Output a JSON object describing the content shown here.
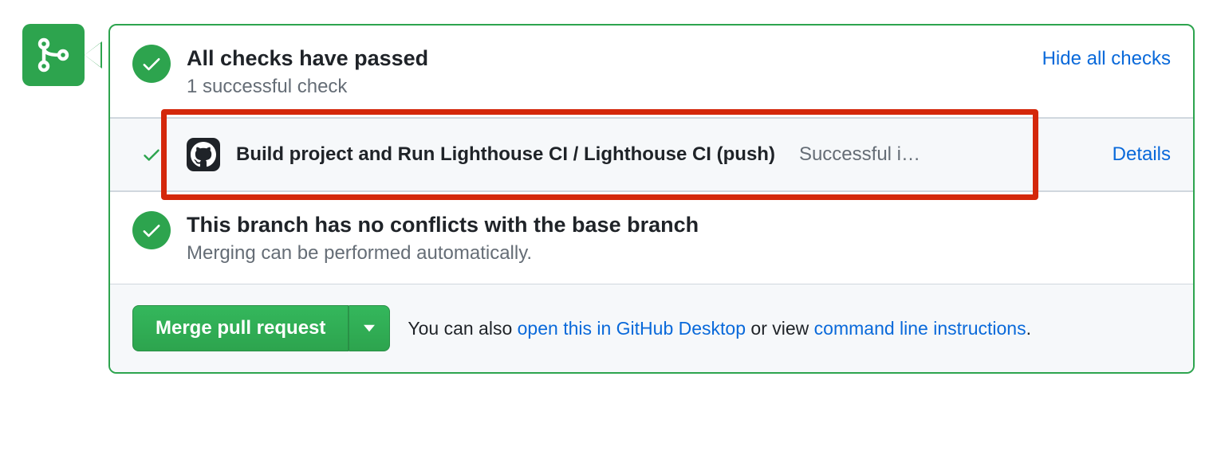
{
  "checks": {
    "title": "All checks have passed",
    "subtitle": "1 successful check",
    "toggle_label": "Hide all checks",
    "items": [
      {
        "name": "Build project and Run Lighthouse CI / Lighthouse CI (push)",
        "status": "Successful i…",
        "details_label": "Details"
      }
    ]
  },
  "conflicts": {
    "title": "This branch has no conflicts with the base branch",
    "subtitle": "Merging can be performed automatically."
  },
  "merge": {
    "button_label": "Merge pull request",
    "help_prefix": "You can also ",
    "desktop_link": "open this in GitHub Desktop",
    "help_middle": " or view ",
    "cli_link": "command line instructions",
    "help_suffix": "."
  }
}
